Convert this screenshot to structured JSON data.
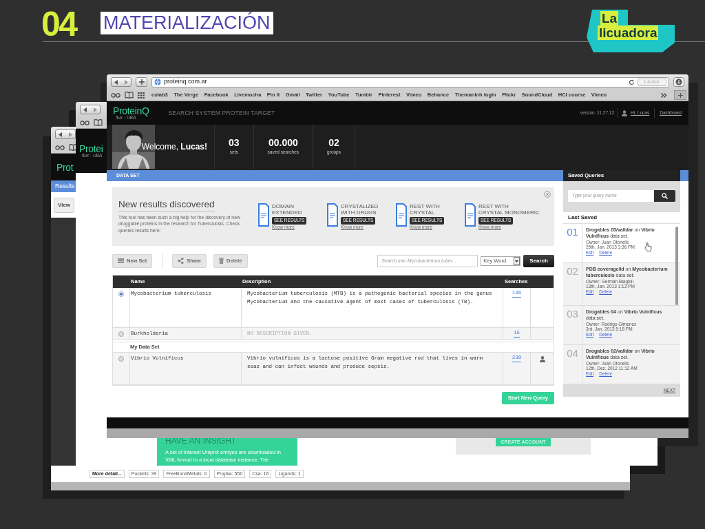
{
  "slide": {
    "number": "04",
    "title": "MATERIALIZACIÓN",
    "logo": [
      "La",
      "licuadora"
    ]
  },
  "back_window": {
    "logo": "Prot",
    "tab": "Results",
    "view_button": "View",
    "tags": [
      {
        "label": "More detail...",
        "bold": true
      },
      {
        "label": "Pockets: 39",
        "bold": false
      },
      {
        "label": "FreeBondMetals: 0",
        "bold": false
      },
      {
        "label": "Propka: 550",
        "bold": false
      },
      {
        "label": "Csa: 16",
        "bold": false
      },
      {
        "label": "Ligands: 1",
        "bold": false
      }
    ]
  },
  "middle_window": {
    "logo": "Protei",
    "logo_sub": "flux · UBA",
    "insight_title": "HAVE AN INSIGHT",
    "insight_text": "A set of interest Uniprot entryes are downloaded in XML format to a local database instance. The",
    "create_button": "CREATE ACCOUNT"
  },
  "browser": {
    "url": "proteinq.com.ar",
    "reader_button": "Lector",
    "bookmarks": [
      "colab3",
      "The Verge",
      "Facebook",
      "Livemocha",
      "Pin It",
      "Gmail",
      "Twitter",
      "YouTube",
      "Tumblr",
      "Pinterest",
      "Vimeo",
      "Behance",
      "Themaninh login",
      "Flickr",
      "SoundCloud",
      "HCI course",
      "Vimeo"
    ]
  },
  "app": {
    "logo": "ProteinQ",
    "logo_sub": "flux · UBA",
    "tagline": "SEARCH SYSTEM PROTEIN TARGET",
    "version": "version: 11.27.12",
    "user": "Hi, Lucas",
    "dashboard": "Dashboard",
    "welcome": "Welcome, **Lucas!**",
    "stats": [
      {
        "value": "03",
        "label": "sets"
      },
      {
        "value": "00.000",
        "label": "saved searches"
      },
      {
        "value": "02",
        "label": "groups"
      }
    ]
  },
  "data_set": {
    "title": "DATA SET",
    "notice": {
      "title": "New results discovered",
      "text": "This tool has been such a big help for the discovery of new druggable proteins in the research for Tuberculosis. Check queries results here:",
      "results": [
        {
          "lines": [
            "DOMAIN",
            "EXTENDED"
          ],
          "button": "SEE RESULTS",
          "link": "Know more"
        },
        {
          "lines": [
            "CRYSTALIZED",
            "WITH DRUGS"
          ],
          "button": "SEE RESULTS",
          "link": "Know more"
        },
        {
          "lines": [
            "REST WITH",
            "CRYSTAL"
          ],
          "button": "SEE RESULTS",
          "link": "Know more"
        },
        {
          "lines": [
            "REST WITH",
            "CRYSTAL MONOMERIC"
          ],
          "button": "SEE RESULTS",
          "link": "Know more"
        }
      ]
    },
    "toolbar": {
      "buttons": [
        {
          "kind": "list",
          "label": "New Set"
        },
        {
          "kind": "share",
          "label": "Share"
        },
        {
          "kind": "trash",
          "label": "Delete"
        }
      ],
      "search_placeholder": "Search into Mycobacterium tuber...",
      "filter": "Key Word",
      "search_button": "Search"
    },
    "table": {
      "columns": [
        "Name",
        "Description",
        "Searches"
      ],
      "rows": [
        {
          "kind": "item",
          "selected": true,
          "name": "Mycobacterium tuberculosis",
          "description": "Mycobacterium tuberculosis (MTB) is a pathogenic bacterial species in the genus Mycobacterium and the causative agent of most cases of tuberculosis (TB).",
          "empty": false,
          "searches": "136",
          "owned": false
        },
        {
          "kind": "item",
          "selected": false,
          "name": "Burkholderia",
          "description": "NO DESCRIPTION GIVEN.",
          "empty": true,
          "searches": "15",
          "owned": false
        },
        {
          "kind": "group",
          "name": "My Data Set"
        },
        {
          "kind": "item",
          "selected": false,
          "name": "Vibrio Vulnificus",
          "description": "Vibrio vulnificus is a lactose positive Gram negative rod that lives in warm seas and can infect wounds and produce sepsis.",
          "empty": false,
          "searches": "238",
          "owned": true
        }
      ]
    },
    "start_button": "Start New Query"
  },
  "saved_queries": {
    "title": "Saved Queries",
    "search_placeholder": "Type your query name",
    "section": "Last Saved",
    "next": "NEXT",
    "items": [
      {
        "number": "01",
        "selected": true,
        "text": "**Drogables 05/validar** on **Vibrio Vulnificus** data set.",
        "owner": "Owner: Juan Otonello",
        "date": "25th, Jan. 2013  3:36 PM",
        "actions": [
          "Edit",
          "Delete"
        ]
      },
      {
        "number": "02",
        "selected": false,
        "text": "**PDB coverage/id** on **Mycobacterium tuberculosis** data set.",
        "owner": "Owner: Germán Biagioli",
        "date": "13th, Jan. 2013  1:13 PM",
        "actions": [
          "Edit",
          "Delete"
        ]
      },
      {
        "number": "03",
        "selected": false,
        "text": "**Drogables 04** on **Vibrio Vulnificus** data set.",
        "owner": "Owner: Rodrigo Gimenez",
        "date": "3rd, Jan. 2013  5:18 PM",
        "actions": [
          "Edit",
          "Delete"
        ]
      },
      {
        "number": "04",
        "selected": false,
        "text": "**Drogables 02/validar** on **Vibrio Vulnificus** data set.",
        "owner": "Owner: Juan Otonello",
        "date": "12th, Dec. 2012  11:12 AM",
        "actions": [
          "Edit",
          "Delete"
        ]
      }
    ]
  }
}
